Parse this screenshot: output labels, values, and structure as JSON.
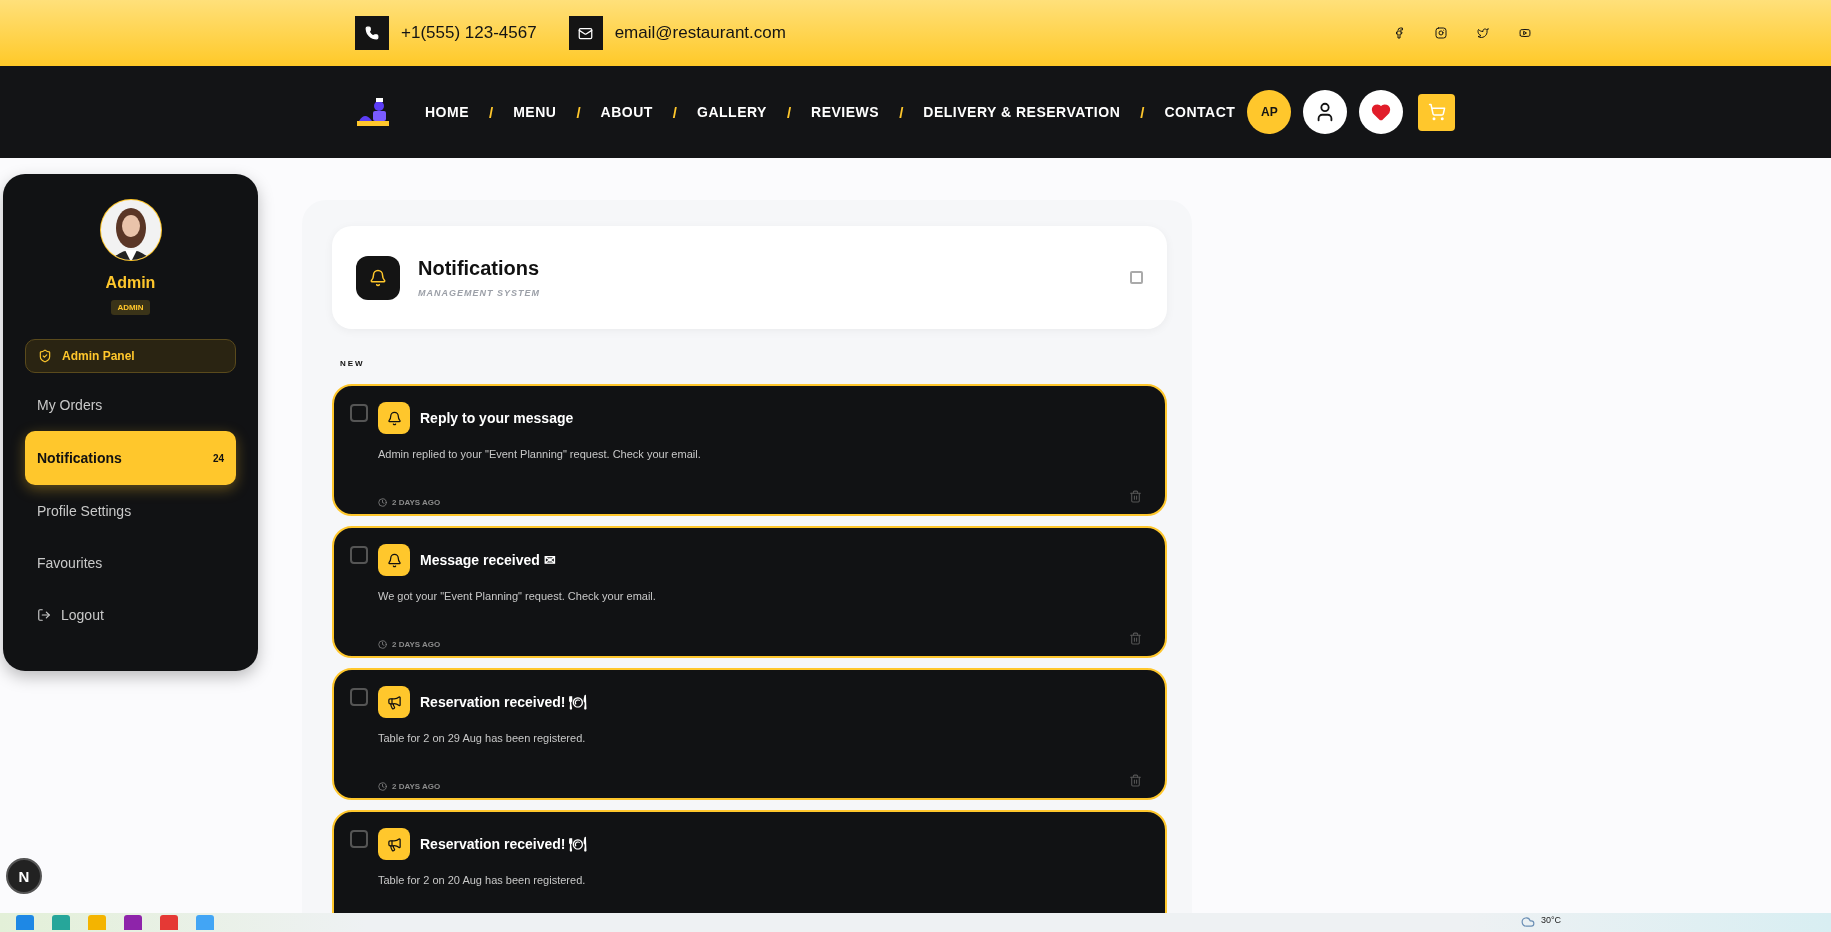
{
  "topbar": {
    "phone": "+1(555) 123-4567",
    "email": "email@restaurant.com",
    "social": [
      {
        "kind": "facebook"
      },
      {
        "kind": "instagram"
      },
      {
        "kind": "twitter"
      },
      {
        "kind": "youtube"
      }
    ]
  },
  "nav": {
    "links": [
      "HOME",
      "MENU",
      "ABOUT",
      "GALLERY",
      "REVIEWS",
      "DELIVERY & RESERVATION",
      "CONTACT"
    ],
    "separator": "/",
    "avatar_initials": "AP"
  },
  "sidebar": {
    "name": "Admin",
    "role": "ADMIN",
    "admin_panel": "Admin Panel",
    "items": [
      {
        "kind": "link",
        "label": "My Orders",
        "selected": false
      },
      {
        "kind": "link",
        "label": "Notifications",
        "selected": true,
        "count": "24"
      },
      {
        "kind": "link",
        "label": "Profile Settings",
        "selected": false
      },
      {
        "kind": "link",
        "label": "Favourites",
        "selected": false
      },
      {
        "kind": "logout",
        "label": "Logout",
        "selected": false
      }
    ]
  },
  "panel": {
    "title": "Notifications",
    "subtitle": "MANAGEMENT SYSTEM",
    "select_all_checked": false,
    "section": "NEW",
    "notifications": [
      {
        "kind": "bell",
        "title": "Reply to your message",
        "body": "Admin replied to your \"Event Planning\" request. Check your email.",
        "time": "2 DAYS AGO",
        "checked": false
      },
      {
        "kind": "bell",
        "title": "Message received ✉",
        "body": "We got your \"Event Planning\" request. Check your email.",
        "time": "2 DAYS AGO",
        "checked": false
      },
      {
        "kind": "megaphone",
        "title": "Reservation received! 🍽",
        "body": "Table for 2 on 29 Aug has been registered.",
        "time": "2 DAYS AGO",
        "checked": false
      },
      {
        "kind": "megaphone",
        "title": "Reservation received! 🍽",
        "body": "Table for 2 on 20 Aug has been registered.",
        "checked": false
      }
    ]
  },
  "dev_badge": "N",
  "taskbar": {
    "weather": "30°C"
  }
}
